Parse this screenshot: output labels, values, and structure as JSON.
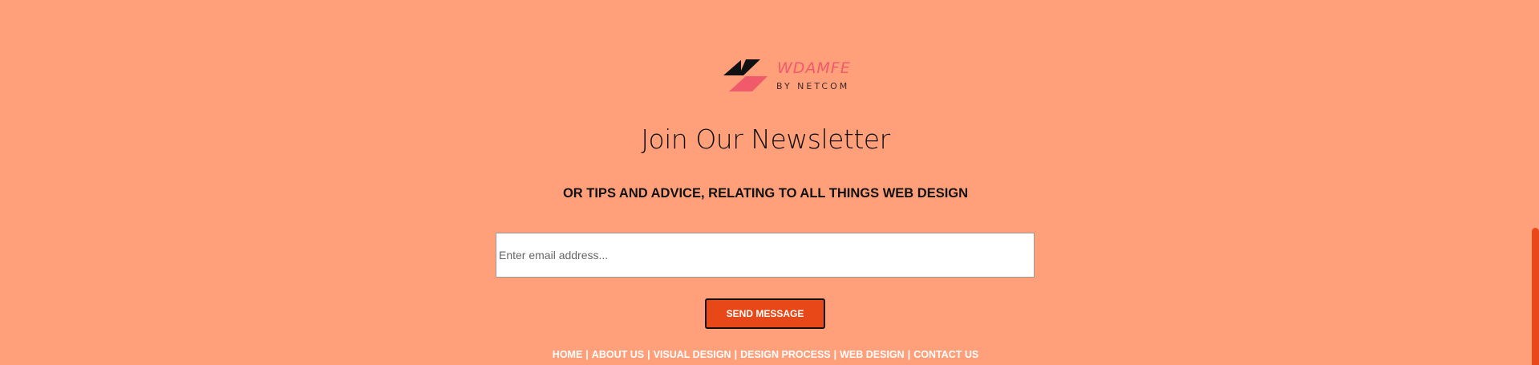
{
  "brand": {
    "name": "WDAMFE",
    "sub": "BY NETCOM",
    "logo_icon": "stacked-parallelogram-logo"
  },
  "newsletter": {
    "title": "Join Our Newsletter",
    "subtitle": "OR TIPS AND ADVICE, RELATING TO ALL THINGS WEB DESIGN",
    "email_placeholder": "Enter email address...",
    "email_value": "",
    "send_label": "SEND MESSAGE"
  },
  "footer": {
    "links": [
      {
        "label": "HOME"
      },
      {
        "label": "ABOUT US"
      },
      {
        "label": "VISUAL DESIGN"
      },
      {
        "label": "DESIGN PROCESS"
      },
      {
        "label": "WEB DESIGN"
      },
      {
        "label": "CONTACT US"
      }
    ],
    "separator": "|"
  },
  "colors": {
    "background": "#ffa07a",
    "accent": "#e84817",
    "brand_pink": "#f05a6a"
  }
}
